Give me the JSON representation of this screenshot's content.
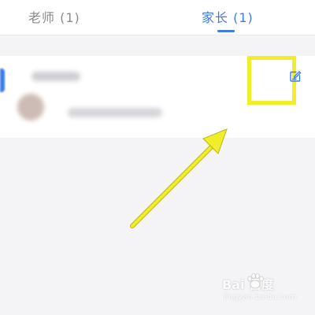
{
  "tabs": {
    "teacher_label": "老师 (1)",
    "parent_label": "家长 (1)",
    "active_color": "#3d7be6",
    "inactive_color": "#8a8a8a"
  },
  "member_card": {
    "edit_icon": "edit-icon"
  },
  "annotation": {
    "highlight_color": "#f0ee2a",
    "arrow_color": "#f0ee2a"
  },
  "watermark": {
    "logo_text": "Bai  百度",
    "sub_text": "jingyan.baidu.com"
  }
}
